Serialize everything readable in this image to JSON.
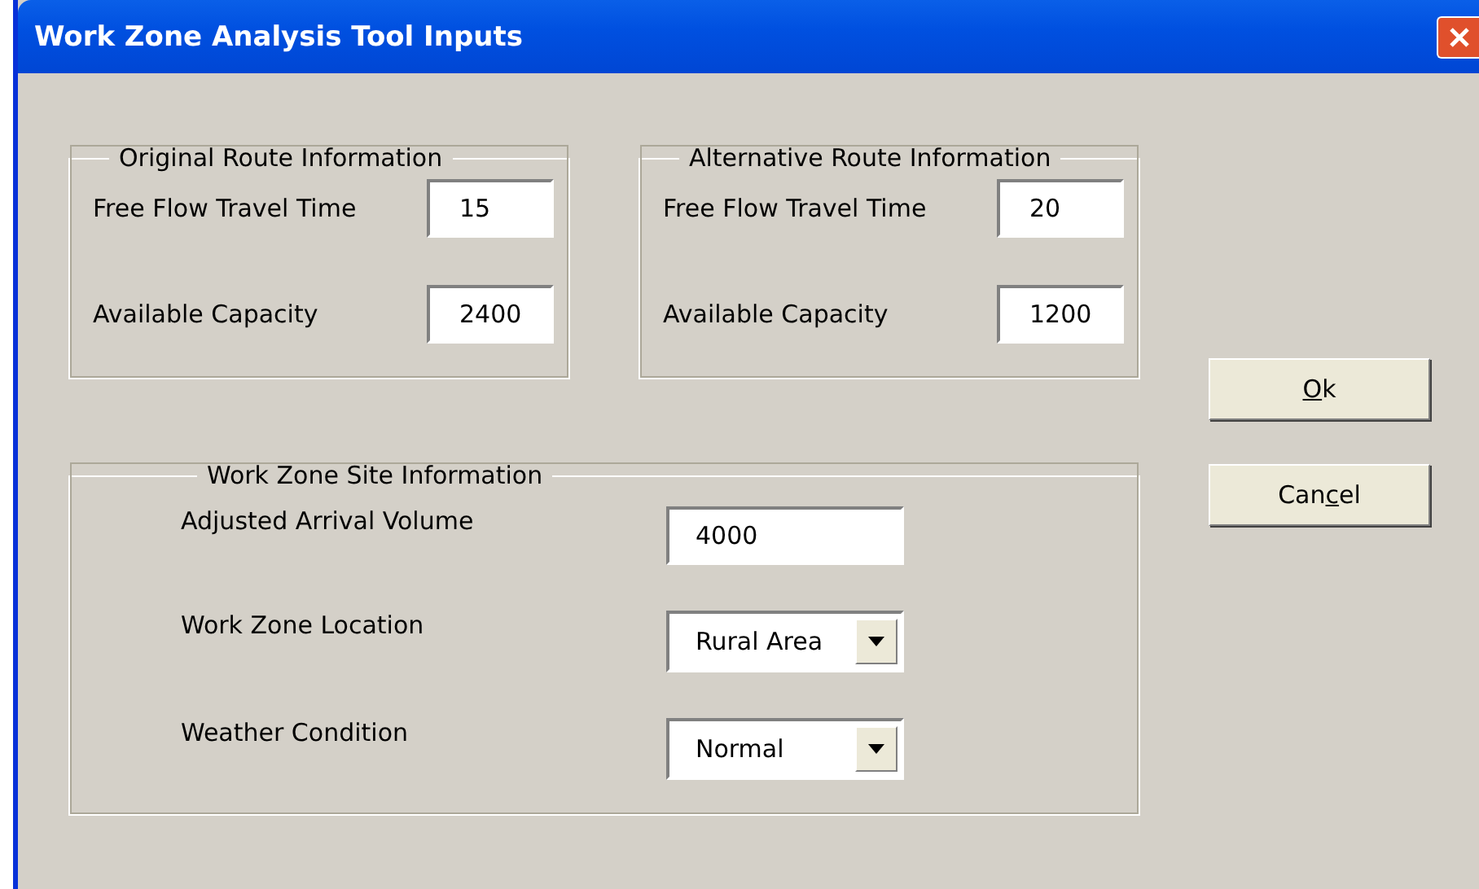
{
  "window": {
    "title": "Work Zone Analysis Tool Inputs"
  },
  "route_groups": [
    {
      "title": "Original Route Information",
      "fields": [
        {
          "label": "Free Flow Travel Time",
          "value": "15"
        },
        {
          "label": "Available Capacity",
          "value": "2400"
        }
      ]
    },
    {
      "title": "Alternative Route Information",
      "fields": [
        {
          "label": "Free Flow Travel Time",
          "value": "20"
        },
        {
          "label": "Available Capacity",
          "value": "1200"
        }
      ]
    }
  ],
  "site_group": {
    "title": "Work Zone Site Information",
    "fields": [
      {
        "kind": "text",
        "label": "Adjusted Arrival Volume",
        "value": "4000"
      },
      {
        "kind": "dropdown",
        "label": "Work Zone Location",
        "value": "Rural Area"
      },
      {
        "kind": "dropdown",
        "label": "Weather Condition",
        "value": "Normal"
      }
    ]
  },
  "buttons": [
    {
      "accelerator": "O",
      "after": "k"
    },
    {
      "before": "Can",
      "accelerator": "c",
      "after": "el"
    }
  ]
}
